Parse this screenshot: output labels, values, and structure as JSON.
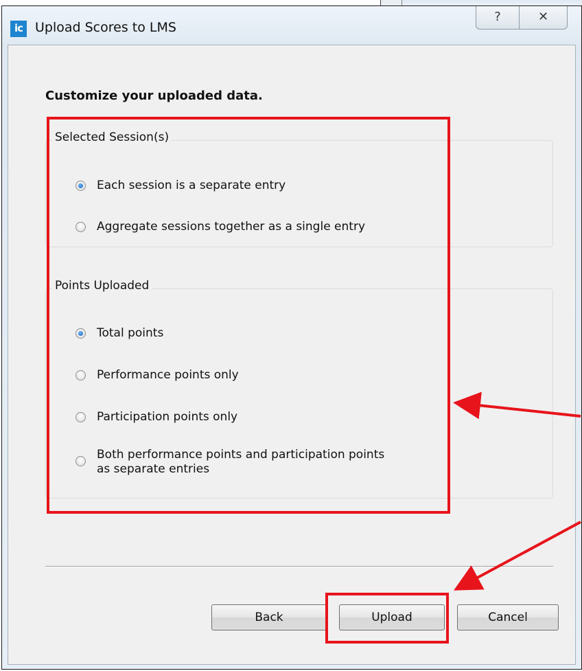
{
  "window": {
    "title": "Upload Scores to LMS",
    "app_icon_text": "ic",
    "help_glyph": "?",
    "close_glyph": "✕"
  },
  "content": {
    "heading": "Customize your uploaded data."
  },
  "sessions_group": {
    "legend": "Selected Session(s)",
    "options": [
      {
        "label": "Each session is a separate entry",
        "checked": true
      },
      {
        "label": "Aggregate sessions together as a single entry",
        "checked": false
      }
    ]
  },
  "points_group": {
    "legend": "Points Uploaded",
    "options": [
      {
        "label": "Total points",
        "checked": true
      },
      {
        "label": "Performance points only",
        "checked": false
      },
      {
        "label": "Participation points only",
        "checked": false
      },
      {
        "label_line1": "Both performance points and participation points",
        "label_line2": "as separate entries",
        "checked": false
      }
    ]
  },
  "buttons": {
    "back": "Back",
    "upload": "Upload",
    "cancel": "Cancel"
  },
  "annotations": {
    "color": "#e8141b"
  }
}
